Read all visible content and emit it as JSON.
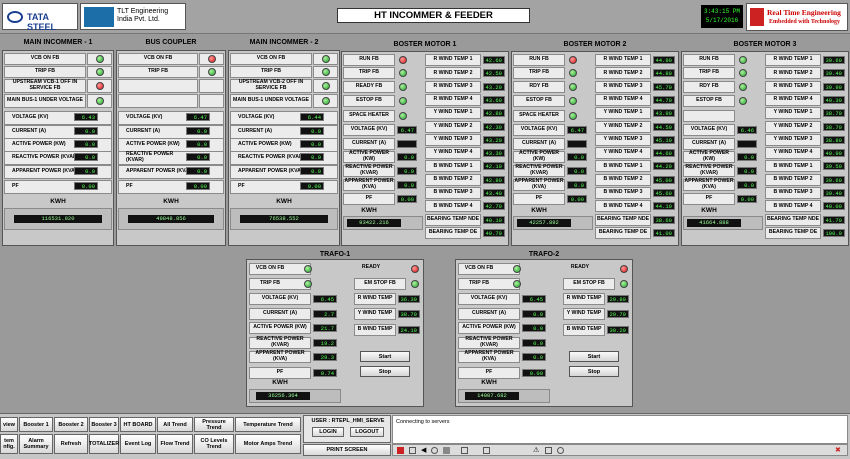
{
  "header": {
    "company1": "TATA STEEL",
    "company2_line1": "TLT Engineering",
    "company2_line2": "India Pvt. Ltd.",
    "title": "HT INCOMMER & FEEDER",
    "time": "3:43:15 PM",
    "date": "5/17/2016",
    "rte_line1": "Real Time Engineering",
    "rte_line2": "Embedded with Technology"
  },
  "incomers": [
    {
      "title": "MAIN INCOMMER - 1",
      "rows": [
        {
          "label": "VCB ON FB",
          "led": "green"
        },
        {
          "label": "TRIP FB",
          "led": "green"
        },
        {
          "label": "UPSTREAM VCB-1 OFF IN SERVICE FB",
          "led": "red"
        },
        {
          "label": "MAIN BUS-1 UNDER VOLTAGE",
          "led": "green"
        }
      ],
      "voltage_label": "VOLTAGE (KV)",
      "voltage": "6.43",
      "current_label": "CURRENT (A)",
      "current": "0.0",
      "active_label": "ACTIVE POWER (KW)",
      "active": "0.0",
      "reactive_label": "REACTIVE POWER (KVAR)",
      "reactive": "0.0",
      "apparent_label": "APPARENT POWER (KVA)",
      "apparent": "0.0",
      "pf_label": "PF",
      "pf": "0.00",
      "kwh_label": "KWH",
      "kwh": "116531.920"
    },
    {
      "title": "BUS COUPLER",
      "rows": [
        {
          "label": "VCB ON FB",
          "led": "red"
        },
        {
          "label": "TRIP FB",
          "led": "green"
        },
        {
          "label": "",
          "led": ""
        },
        {
          "label": "",
          "led": ""
        }
      ],
      "voltage_label": "VOLTAGE (KV)",
      "voltage": "6.47",
      "current_label": "CURRENT (A)",
      "current": "0.0",
      "active_label": "ACTIVE POWER (KW)",
      "active": "0.0",
      "reactive_label": "REACTIVE POWER (KVAR)",
      "reactive": "0.0",
      "apparent_label": "APPARENT POWER (KVA)",
      "apparent": "0.0",
      "pf_label": "PF",
      "pf": "0.00",
      "kwh_label": "KWH",
      "kwh": "49848.856"
    },
    {
      "title": "MAIN INCOMMER - 2",
      "rows": [
        {
          "label": "VCB ON FB",
          "led": "green"
        },
        {
          "label": "TRIP FB",
          "led": "green"
        },
        {
          "label": "UPSTREAM VCB-2 OFF IN SERVICE FB",
          "led": "green"
        },
        {
          "label": "MAIN BUS-1 UNDER VOLTAGE",
          "led": "green"
        }
      ],
      "voltage_label": "VOLTAGE (KV)",
      "voltage": "6.44",
      "current_label": "CURRENT (A)",
      "current": "0.0",
      "active_label": "ACTIVE POWER (KW)",
      "active": "0.0",
      "reactive_label": "REACTIVE POWER (KVAR)",
      "reactive": "0.0",
      "apparent_label": "APPARENT POWER (KVA)",
      "apparent": "0.0",
      "pf_label": "PF",
      "pf": "0.00",
      "kwh_label": "KWH",
      "kwh": "76538.552"
    }
  ],
  "motors": [
    {
      "title": "BOSTER MOTOR 1",
      "left": [
        {
          "label": "RUN FB",
          "led": "red"
        },
        {
          "label": "TRIP FB",
          "led": "green"
        },
        {
          "label": "READY FB",
          "led": "green"
        },
        {
          "label": "ESTOP FB",
          "led": "green"
        },
        {
          "label": "SPACE HEATER",
          "led": "green"
        }
      ],
      "voltage_label": "VOLTAGE (KV)",
      "voltage": "6.47",
      "current_label": "CURRENT (A)",
      "current": "",
      "active_label": "ACTIVE POWER (KW)",
      "active": "0.0",
      "reactive_label": "REACTIVE POWER (KVAR)",
      "reactive": "0.0",
      "apparent_label": "APPARENT POWER (KVA)",
      "apparent": "0.0",
      "pf_label": "PF",
      "pf": "0.00",
      "kwh_label": "KWH",
      "kwh": "93422.216",
      "temps": [
        {
          "label": "R WIND TEMP 1",
          "value": "42.60"
        },
        {
          "label": "R WIND TEMP 2",
          "value": "42.50"
        },
        {
          "label": "R WIND TEMP 3",
          "value": "43.20"
        },
        {
          "label": "R WIND TEMP 4",
          "value": "43.60"
        },
        {
          "label": "Y WIND TEMP 1",
          "value": "42.80"
        },
        {
          "label": "Y WIND TEMP 2",
          "value": "42.30"
        },
        {
          "label": "Y WIND TEMP 3",
          "value": "43.20"
        },
        {
          "label": "Y WIND TEMP 4",
          "value": "43.30"
        },
        {
          "label": "B WIND TEMP 1",
          "value": "42.10"
        },
        {
          "label": "B WIND TEMP 2",
          "value": "42.80"
        },
        {
          "label": "B WIND TEMP 3",
          "value": "43.40"
        },
        {
          "label": "B WIND TEMP 4",
          "value": "42.70"
        },
        {
          "label": "BEARING TEMP NDE",
          "value": "40.10"
        },
        {
          "label": "BEARING TEMP DE",
          "value": "40.70"
        }
      ]
    },
    {
      "title": "BOSTER MOTOR 2",
      "left": [
        {
          "label": "RUN FB",
          "led": "red"
        },
        {
          "label": "TRIP FB",
          "led": "green"
        },
        {
          "label": "RDY FB",
          "led": "green"
        },
        {
          "label": "ESTOP FB",
          "led": "green"
        },
        {
          "label": "SPACE HEATER",
          "led": "green"
        }
      ],
      "voltage_label": "VOLTAGE (KV)",
      "voltage": "6.47",
      "current_label": "CURRENT (A)",
      "current": "",
      "active_label": "ACTIVE POWER (KW)",
      "active": "0.0",
      "reactive_label": "REACTIVE POWER (KVAR)",
      "reactive": "0.0",
      "apparent_label": "APPARENT POWER (KVA)",
      "apparent": "0.0",
      "pf_label": "PF",
      "pf": "0.00",
      "kwh_label": "KWH",
      "kwh": "42257.892",
      "temps": [
        {
          "label": "R WIND TEMP 1",
          "value": "44.90"
        },
        {
          "label": "R WIND TEMP 2",
          "value": "44.80"
        },
        {
          "label": "R WIND TEMP 3",
          "value": "45.70"
        },
        {
          "label": "R WIND TEMP 4",
          "value": "44.70"
        },
        {
          "label": "Y WIND TEMP 1",
          "value": "43.90"
        },
        {
          "label": "Y WIND TEMP 2",
          "value": "44.50"
        },
        {
          "label": "Y WIND TEMP 3",
          "value": "45.10"
        },
        {
          "label": "Y WIND TEMP 4",
          "value": "44.60"
        },
        {
          "label": "B WIND TEMP 1",
          "value": "44.20"
        },
        {
          "label": "B WIND TEMP 2",
          "value": "45.00"
        },
        {
          "label": "B WIND TEMP 3",
          "value": "45.60"
        },
        {
          "label": "B WIND TEMP 4",
          "value": "44.10"
        },
        {
          "label": "BEARING TEMP NDE",
          "value": "38.60"
        },
        {
          "label": "BEARING TEMP DE",
          "value": "41.00"
        }
      ]
    },
    {
      "title": "BOSTER MOTOR 3",
      "left": [
        {
          "label": "RUN FB",
          "led": "green"
        },
        {
          "label": "TRIP FB",
          "led": "green"
        },
        {
          "label": "RDY FB",
          "led": "green"
        },
        {
          "label": "ESTOP FB",
          "led": "green"
        },
        {
          "label": "",
          "led": ""
        }
      ],
      "voltage_label": "VOLTAGE (KV)",
      "voltage": "6.46",
      "current_label": "CURRENT (A)",
      "current": "",
      "active_label": "ACTIVE POWER (KW)",
      "active": "0.0",
      "reactive_label": "REACTIVE POWER (KVAR)",
      "reactive": "0.0",
      "apparent_label": "APPARENT POWER (KVA)",
      "apparent": "0.0",
      "pf_label": "PF",
      "pf": "0.00",
      "kwh_label": "KWH",
      "kwh": "41664.888",
      "temps": [
        {
          "label": "R WIND TEMP 1",
          "value": "39.60"
        },
        {
          "label": "R WIND TEMP 2",
          "value": "39.40"
        },
        {
          "label": "R WIND TEMP 3",
          "value": "39.90"
        },
        {
          "label": "R WIND TEMP 4",
          "value": "40.30"
        },
        {
          "label": "Y WIND TEMP 1",
          "value": "38.70"
        },
        {
          "label": "Y WIND TEMP 2",
          "value": "38.70"
        },
        {
          "label": "Y WIND TEMP 3",
          "value": "38.80"
        },
        {
          "label": "Y WIND TEMP 4",
          "value": "40.90"
        },
        {
          "label": "B WIND TEMP 1",
          "value": "39.50"
        },
        {
          "label": "B WIND TEMP 2",
          "value": "39.60"
        },
        {
          "label": "B WIND TEMP 3",
          "value": "39.40"
        },
        {
          "label": "B WIND TEMP 4",
          "value": "40.00"
        },
        {
          "label": "BEARING TEMP NDE",
          "value": "41.70"
        },
        {
          "label": "BEARING TEMP DE",
          "value": "100.0"
        }
      ]
    }
  ],
  "trafos": [
    {
      "title": "TRAFO-1",
      "vcb_label": "VCB ON FB",
      "vcb_led": "green",
      "trip_label": "TRIP FB",
      "trip_led": "green",
      "ready_label": "READY",
      "ready_led": "red",
      "emstop_label": "EM STOP FB",
      "emstop_led": "green",
      "voltage_label": "VOLTAGE (KV)",
      "voltage": "6.45",
      "current_label": "CURRENT (A)",
      "current": "2.7",
      "active_label": "ACTIVE POWER (KW)",
      "active": "21.7",
      "reactive_label": "REACTIVE POWER (KVAR)",
      "reactive": "19.2",
      "apparent_label": "APPARENT POWER (KVA)",
      "apparent": "29.3",
      "pf_label": "PF",
      "pf": "0.74",
      "rwind_label": "R WIND TEMP",
      "rwind": "36.30",
      "ywind_label": "Y WIND TEMP",
      "ywind": "38.70",
      "bwind_label": "B WIND TEMP",
      "bwind": "24.10",
      "start": "Start",
      "stop": "Stop",
      "kwh_label": "KWH",
      "kwh": "36256.364"
    },
    {
      "title": "TRAFO-2",
      "vcb_label": "VCB ON FB",
      "vcb_led": "green",
      "trip_label": "TRIP FB",
      "trip_led": "green",
      "ready_label": "READY",
      "ready_led": "red",
      "emstop_label": "EM STOP FB",
      "emstop_led": "green",
      "voltage_label": "VOLTAGE (KV)",
      "voltage": "6.45",
      "current_label": "CURRENT (A)",
      "current": "0.0",
      "active_label": "ACTIVE POWER (KW)",
      "active": "0.0",
      "reactive_label": "REACTIVE POWER (KVAR)",
      "reactive": "0.0",
      "apparent_label": "APPARENT POWER (KVA)",
      "apparent": "0.0",
      "pf_label": "PF",
      "pf": "0.00",
      "rwind_label": "R WIND TEMP",
      "rwind": "29.80",
      "ywind_label": "Y WIND TEMP",
      "ywind": "29.70",
      "bwind_label": "B WIND TEMP",
      "bwind": "30.20",
      "start": "Start",
      "stop": "Stop",
      "kwh_label": "KWH",
      "kwh": "14007.682"
    }
  ],
  "nav": {
    "view": "view",
    "booster1": "Booster 1",
    "booster2": "Booster 2",
    "booster3": "Booster 3",
    "ht_board": "HT BOARD",
    "all_trend": "All Trend",
    "pressure_trend": "Pressure Trend",
    "temperature_trend": "Temperature Trend",
    "item_cfg": "tem nfig.",
    "alarm_summary": "Alarm Summary",
    "refresh": "Refresh",
    "totalizer": "TOTALIZER",
    "event_log": "Event Log",
    "flow_trend": "Flow Trend",
    "co_levels_trend": "CO Levels Trend",
    "motor_amps_trend": "Motor Amps Trend"
  },
  "user": {
    "label": "USER : RTEPL_HMI_SERVE",
    "login": "LOGIN",
    "logout": "LOGOUT",
    "print": "PRINT SCREEN"
  },
  "messages": {
    "line1": "Connecting to servers"
  },
  "colors": {
    "led_green": "#1ea82a",
    "led_red": "#dd1111",
    "value_bg": "#111111",
    "value_fg": "#55ff55"
  }
}
